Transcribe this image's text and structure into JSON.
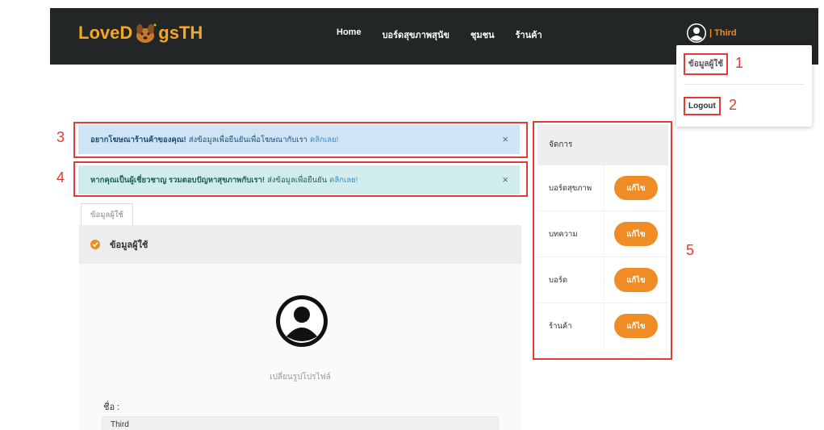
{
  "header": {
    "logo_left": "LoveD",
    "logo_right": "gsTH",
    "nav": [
      "Home",
      "บอร์ดสุขภาพสุนัข",
      "ชุมชน",
      "ร้านค้า"
    ],
    "user_name": "| Third"
  },
  "dropdown": {
    "profile_label": "ข้อมูลผู้ใช้",
    "logout_label": "Logout"
  },
  "markers": [
    "1",
    "2",
    "3",
    "4",
    "5"
  ],
  "alerts": [
    {
      "bold": "อยากโฆษณาร้านค้าของคุณ!",
      "text": "ส่งข้อมูลเพื่อยืนยันเพื่อโฆษณากับเรา",
      "link": "คลิกเลย!",
      "close": "×"
    },
    {
      "bold": "หากคุณเป็นผู้เชี่ยวชาญ รวมตอบปัญหาสุขภาพกับเรา!",
      "text": "ส่งข้อมูลเพื่อยืนยัน",
      "link": "คลิกเลย!",
      "close": "×"
    }
  ],
  "profile": {
    "tab_label": "ข้อมูลผู้ใช้",
    "title": "ข้อมูลผู้ใช้",
    "change_picture": "เปลี่ยนรูปโปรไฟล์",
    "name_label": "ชื่อ :",
    "name_value": "Third"
  },
  "manage": {
    "title": "จัดการ",
    "rows": [
      {
        "label": "บอร์ดสุขภาพ",
        "button": "แก้ไข"
      },
      {
        "label": "บทความ",
        "button": "แก้ไข"
      },
      {
        "label": "บอร์ด",
        "button": "แก้ไข"
      },
      {
        "label": "ร้านค้า",
        "button": "แก้ไข"
      }
    ]
  },
  "colors": {
    "accent": "#f08c24",
    "navbar": "#222627",
    "annotation": "#e53935"
  }
}
